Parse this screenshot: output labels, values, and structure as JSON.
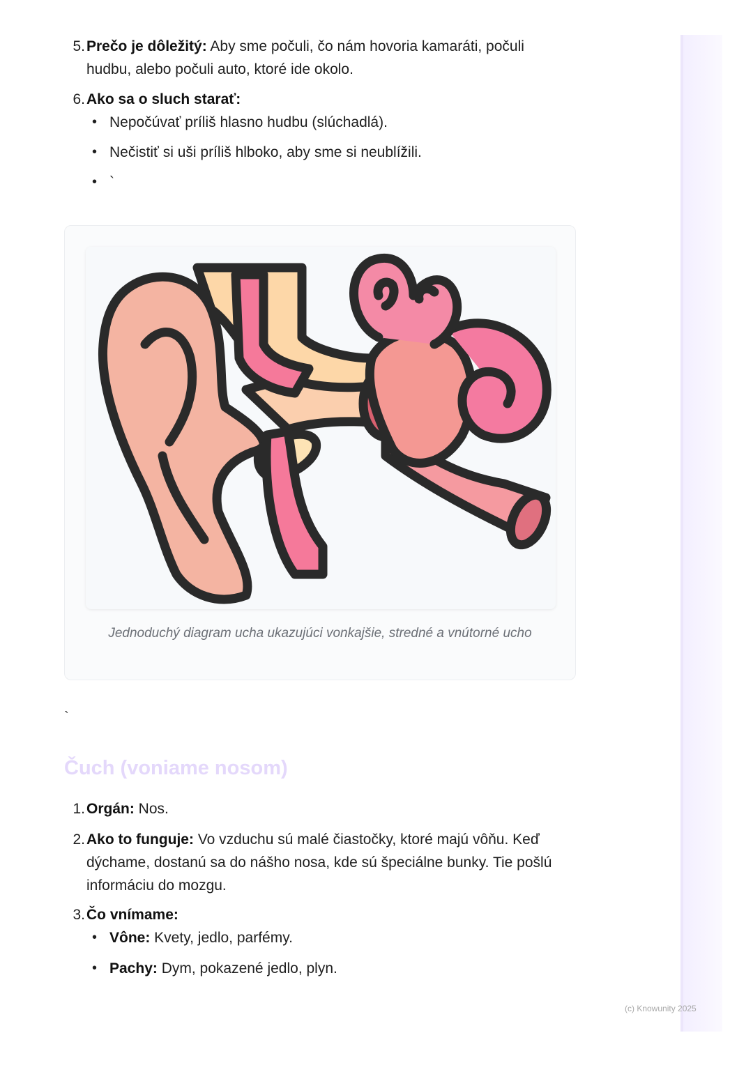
{
  "section1": {
    "item5": {
      "number": "5.",
      "label": "Prečo je dôležitý:",
      "line1": " Aby sme počuli, čo nám hovoria kamaráti, počuli",
      "line2": "hudbu, alebo počuli auto, ktoré ide okolo."
    },
    "item6": {
      "number": "6.",
      "label": "Ako sa o sluch starať:",
      "bullets": [
        "Nepočúvať príliš hlasno hudbu (slúchadlá).",
        "Nečistiť si uši príliš hlboko, aby sme si neublížili.",
        "`"
      ]
    }
  },
  "figure": {
    "image_icon": "ear-anatomy-illustration",
    "caption": "Jednoduchý diagram ucha ukazujúci vonkajšie, stredné a vnútorné ucho"
  },
  "stray_mark": "`",
  "section2": {
    "heading": "Čuch (voniame nosom)",
    "item1": {
      "number": "1.",
      "label": "Orgán:",
      "text": " Nos."
    },
    "item2": {
      "number": "2.",
      "label": "Ako to funguje:",
      "line1": " Vo vzduchu sú malé čiastočky, ktoré majú vôňu. Keď",
      "line2": "dýchame, dostanú sa do nášho nosa, kde sú špeciálne bunky. Tie pošlú",
      "line3": "informáciu do mozgu."
    },
    "item3": {
      "number": "3.",
      "label": "Čo vnímame:",
      "bullets": [
        {
          "label": "Vône:",
          "text": " Kvety, jedlo, parfémy."
        },
        {
          "label": "Pachy:",
          "text": " Dym, pokazené jedlo, plyn."
        }
      ]
    }
  },
  "footer": "(c) Knowunity 2025",
  "colors": {
    "heading": "#e4d8fb",
    "sidebar": "#f3efff",
    "ear_outer": "#f4b0a0",
    "ear_yellow": "#fbd5a5",
    "ear_pink": "#f57a9a",
    "outline": "#2a2a2a"
  }
}
